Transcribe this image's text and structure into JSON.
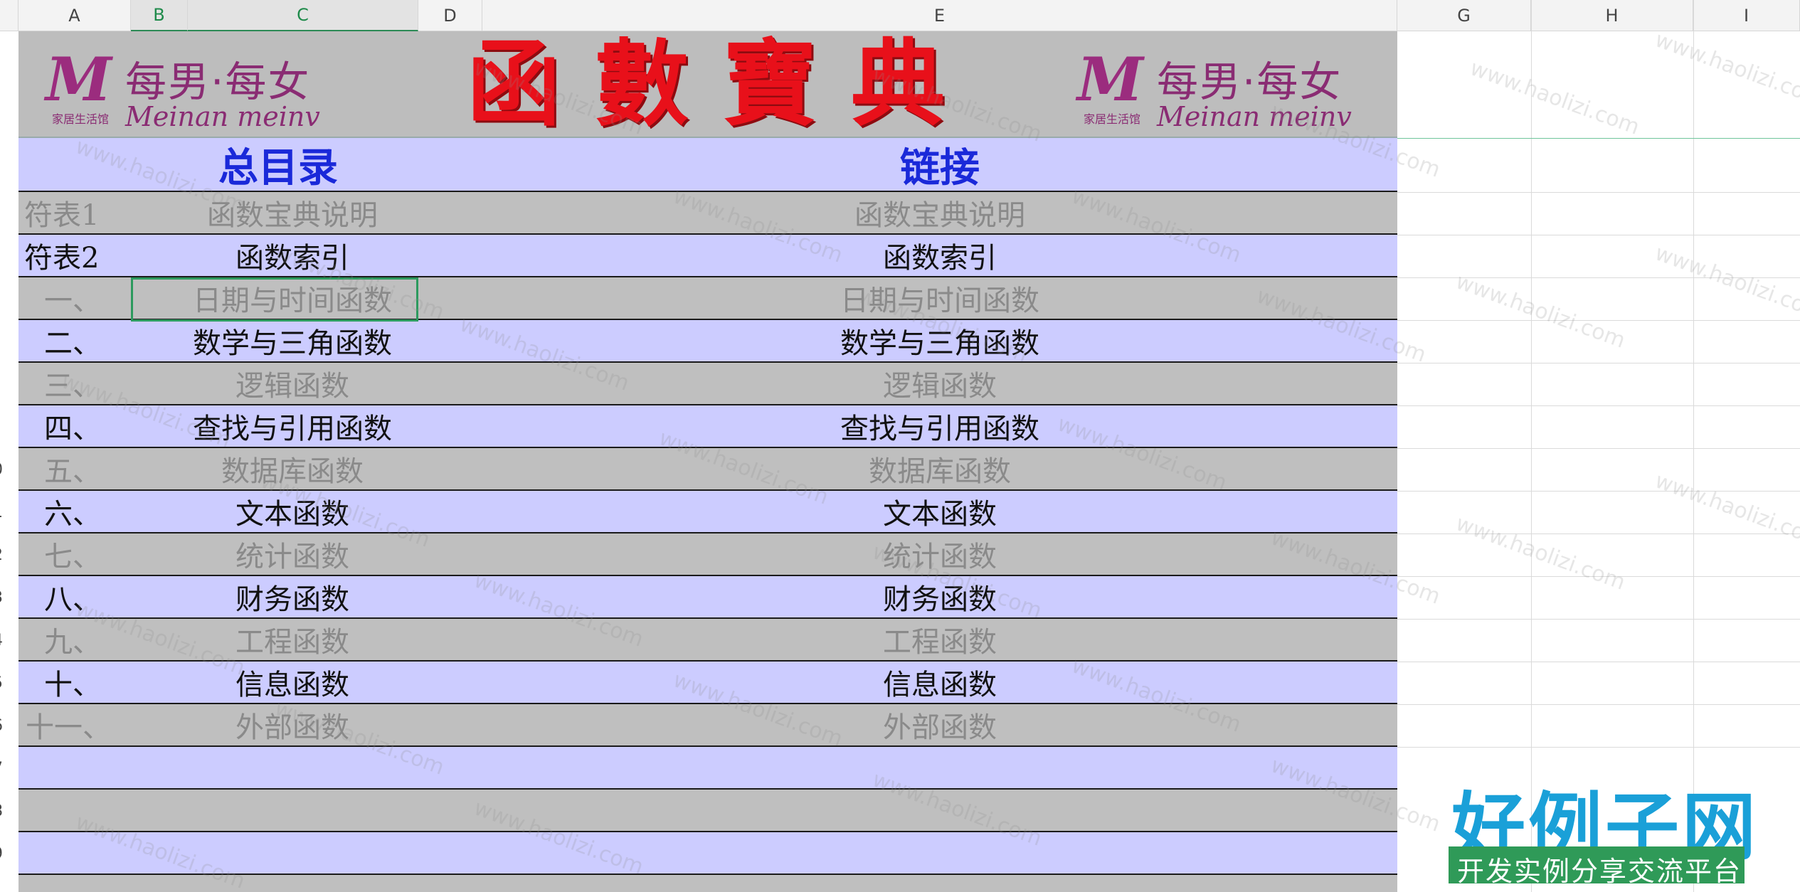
{
  "columns": [
    "A",
    "B",
    "C",
    "D",
    "E",
    "G",
    "H",
    "I"
  ],
  "banner": {
    "title": "函數寶典",
    "logo_cn": "每男·每女",
    "logo_en": "Meinan meinv",
    "logo_sub": "家居生活馆"
  },
  "header_row": {
    "left": "总目录",
    "right": "链接"
  },
  "rows": [
    {
      "num": "",
      "idx": "符表1",
      "name": "函数宝典说明",
      "link": "函数宝典说明"
    },
    {
      "num": "",
      "idx": "符表2",
      "name": "函数索引",
      "link": "函数索引"
    },
    {
      "num": "",
      "idx": "一、",
      "name": "日期与时间函数",
      "link": "日期与时间函数"
    },
    {
      "num": "",
      "idx": "二、",
      "name": "数学与三角函数",
      "link": "数学与三角函数"
    },
    {
      "num": "",
      "idx": "三、",
      "name": "逻辑函数",
      "link": "逻辑函数"
    },
    {
      "num": "",
      "idx": "四、",
      "name": "查找与引用函数",
      "link": "查找与引用函数"
    },
    {
      "num": "0",
      "idx": "五、",
      "name": "数据库函数",
      "link": "数据库函数"
    },
    {
      "num": "1",
      "idx": "六、",
      "name": "文本函数",
      "link": "文本函数"
    },
    {
      "num": "2",
      "idx": "七、",
      "name": "统计函数",
      "link": "统计函数"
    },
    {
      "num": "3",
      "idx": "八、",
      "name": "财务函数",
      "link": "财务函数"
    },
    {
      "num": "4",
      "idx": "九、",
      "name": "工程函数",
      "link": "工程函数"
    },
    {
      "num": "5",
      "idx": "十、",
      "name": "信息函数",
      "link": "信息函数"
    },
    {
      "num": "6",
      "idx": "十一、",
      "name": "外部函数",
      "link": "外部函数"
    },
    {
      "num": "7",
      "idx": "",
      "name": "",
      "link": ""
    },
    {
      "num": "8",
      "idx": "",
      "name": "",
      "link": ""
    },
    {
      "num": "9",
      "idx": "",
      "name": "",
      "link": ""
    }
  ],
  "watermark": "www.haolizi.com",
  "brand": {
    "big": "好例子网",
    "small": "开发实例分享交流平台"
  },
  "colors": {
    "title_red": "#e8101a",
    "header_blue": "#1a29d9",
    "row_gray": "#bfbfbf",
    "row_blue": "#ccccff",
    "selection_green": "#2c9a5e"
  }
}
